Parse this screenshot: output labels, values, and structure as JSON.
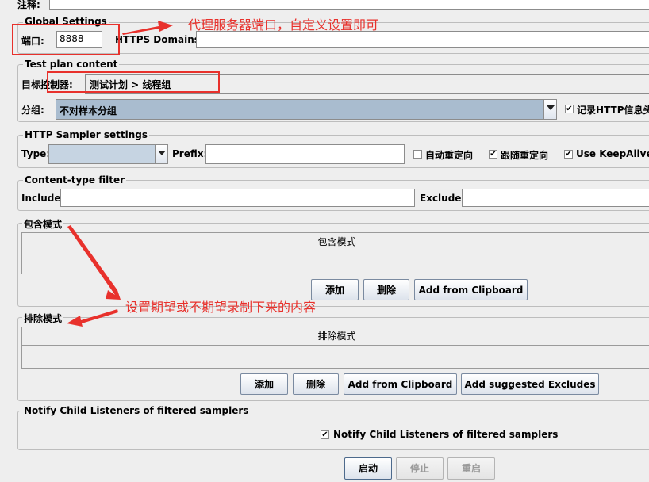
{
  "top": {
    "comment_label": "注释:"
  },
  "global_settings": {
    "legend": "Global Settings",
    "port_label": "端口:",
    "port_value": "8888",
    "https_label": "HTTPS Domains :",
    "https_value": ""
  },
  "test_plan_content": {
    "legend": "Test plan content",
    "target_label": "目标控制器:",
    "target_value": "测试计划 > 线程组",
    "group_label": "分组:",
    "group_value": "不对样本分组",
    "record_http_label": "记录HTTP信息头",
    "record_http_checked": true
  },
  "http_sampler": {
    "legend": "HTTP Sampler settings",
    "type_label": "Type:",
    "type_value": "",
    "prefix_label": "Prefix:",
    "prefix_value": "",
    "auto_redirect_label": "自动重定向",
    "auto_redirect_checked": false,
    "follow_redirect_label": "跟随重定向",
    "follow_redirect_checked": true,
    "keepalive_label": "Use KeepAlive",
    "keepalive_checked": true
  },
  "content_type_filter": {
    "legend": "Content-type filter",
    "include_label": "Include:",
    "include_value": "",
    "exclude_label": "Exclude:",
    "exclude_value": ""
  },
  "include_patterns": {
    "legend": "包含模式",
    "column_header": "包含模式",
    "add_button": "添加",
    "delete_button": "删除",
    "clipboard_button": "Add from Clipboard"
  },
  "exclude_patterns": {
    "legend": "排除模式",
    "column_header": "排除模式",
    "add_button": "添加",
    "delete_button": "删除",
    "clipboard_button": "Add from Clipboard",
    "suggested_button": "Add suggested Excludes"
  },
  "notify": {
    "legend": "Notify Child Listeners of filtered samplers",
    "checkbox_label": "Notify Child Listeners of filtered samplers",
    "checked": true
  },
  "controls": {
    "start_button": "启动",
    "stop_button": "停止",
    "restart_button": "重启"
  },
  "annotations": {
    "proxy_note": "代理服务器端口，自定义设置即可",
    "pattern_note": "设置期望或不期望录制下来的内容",
    "color": "#e8312c"
  }
}
